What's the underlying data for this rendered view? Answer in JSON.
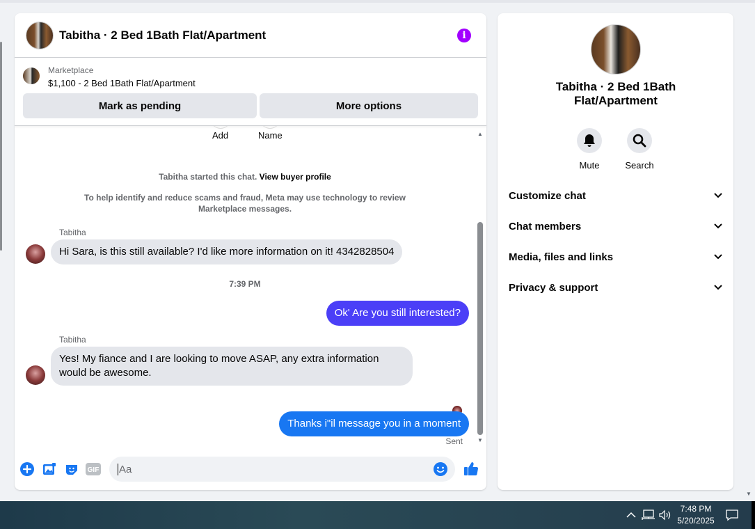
{
  "header": {
    "title": "Tabitha · 2 Bed 1Bath Flat/Apartment"
  },
  "marketplace": {
    "label": "Marketplace",
    "listing": "$1,100 - 2 Bed 1Bath Flat/Apartment",
    "pending_button": "Mark as pending",
    "options_button": "More options"
  },
  "quick_actions": {
    "add": "Add",
    "name": "Name"
  },
  "system": {
    "started_prefix": "Tabitha started this chat.",
    "view_profile": "View buyer profile",
    "scam_notice": "To help identify and reduce scams and fraud, Meta may use technology to review Marketplace messages."
  },
  "messages": [
    {
      "sender": "Tabitha",
      "text": "Hi Sara, is this still available? I'd like more information on it! 4342828504"
    },
    {
      "timestamp": "7:39 PM"
    },
    {
      "text": "Ok' Are you still interested?"
    },
    {
      "sender": "Tabitha",
      "text": "Yes! My fiance and I are looking to move ASAP, any extra information would be awesome."
    },
    {
      "text": "Thanks i\"il message you in a moment",
      "status": "Sent"
    }
  ],
  "composer": {
    "placeholder": "Aa",
    "gif_label": "GIF"
  },
  "panel": {
    "title": "Tabitha · 2 Bed 1Bath Flat/Apartment",
    "mute": "Mute",
    "search": "Search",
    "sections": [
      "Customize chat",
      "Chat members",
      "Media, files and links",
      "Privacy & support"
    ]
  },
  "taskbar": {
    "time": "7:48 PM",
    "date": "5/20/2025"
  },
  "colors": {
    "accent": "#1877f2",
    "outgoing": "#4b3ff7",
    "info": "#a200ff"
  }
}
